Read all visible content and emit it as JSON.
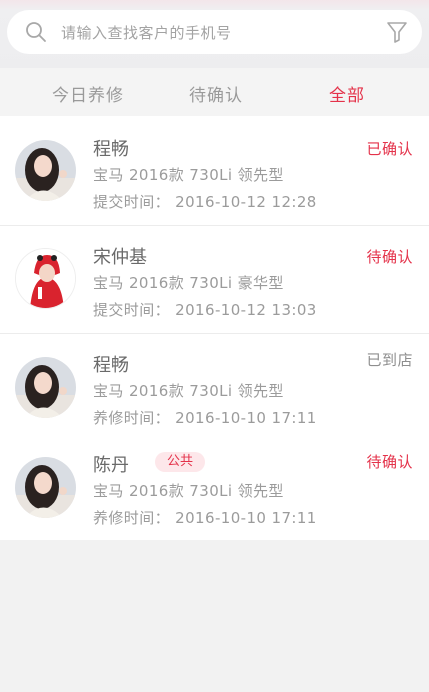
{
  "search": {
    "placeholder": "请输入查找客户的手机号",
    "search_icon": "search-icon",
    "filter_icon": "filter-icon"
  },
  "tabs": [
    {
      "label": "今日养修"
    },
    {
      "label": "待确认"
    },
    {
      "label": "全部",
      "active": true
    }
  ],
  "colors": {
    "accent": "#e4324a",
    "text": "#6a6a6a",
    "muted": "#9b9b9b"
  },
  "orders": [
    {
      "name": "程畅",
      "car": "宝马 2016款 730Li 领先型",
      "time": "提交时间： 2016-10-12  12:28",
      "status": "已确认"
    },
    {
      "name": "宋仲基",
      "car": "宝马 2016款 730Li 豪华型",
      "time": "提交时间： 2016-10-12  13:03",
      "status": "待确认"
    },
    {
      "name": "程畅",
      "car": "宝马 2016款 730Li 领先型",
      "time": "养修时间： 2016-10-10  17:11",
      "status": "已到店"
    },
    {
      "name": "陈丹",
      "badge": "公共",
      "car": "宝马 2016款 730Li 领先型",
      "time": "养修时间： 2016-10-10  17:11",
      "status": "待确认"
    }
  ]
}
